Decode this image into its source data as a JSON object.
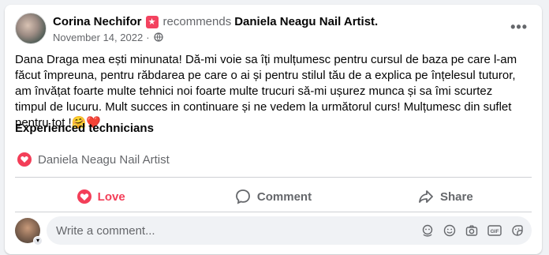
{
  "post": {
    "author": "Corina Nechifor",
    "recommends_text": "recommends",
    "page_name": "Daniela Neagu Nail Artist.",
    "date": "November 14, 2022",
    "date_separator": "·",
    "more_label": "•••",
    "body": "Dana Draga mea ești minunata! Dă-mi voie sa îți mulțumesc pentru cursul de baza pe care l-am făcut împreuna, pentru răbdarea pe care o ai și pentru stilul tău de a explica pe înțelesul tuturor, am învățat foarte multe tehnici noi foarte multe trucuri să-mi ușurez munca și sa îmi scurtez timpul de lucuru. Mult succes in continuare și ne vedem la următorul curs! Mulțumesc din suflet pentru tot !🤗❤️",
    "tag": "Experienced technicians",
    "recommendation_page": "Daniela Neagu Nail Artist"
  },
  "actions": {
    "love": "Love",
    "comment": "Comment",
    "share": "Share"
  },
  "comment_box": {
    "placeholder": "Write a comment..."
  },
  "colors": {
    "love": "#f33e58",
    "secondary_text": "#65676b"
  }
}
